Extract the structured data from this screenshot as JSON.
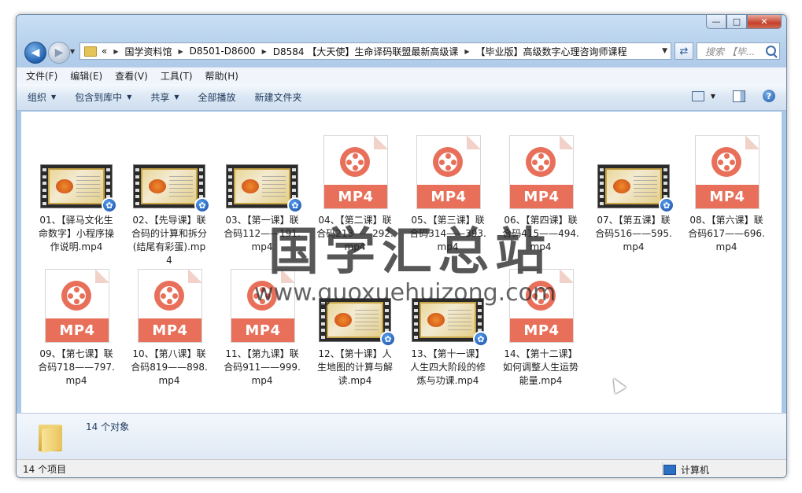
{
  "window": {
    "min_glyph": "—",
    "max_glyph": "□",
    "close_glyph": "✕"
  },
  "address": {
    "crumbs": [
      "«",
      "国学资料馆",
      "D8501-D8600",
      "D8584 【大天使】生命译码联盟最新高级课",
      "【毕业版】高级数字心理咨询师课程"
    ]
  },
  "search": {
    "placeholder": "搜索 【毕..."
  },
  "menu": [
    "文件(F)",
    "编辑(E)",
    "查看(V)",
    "工具(T)",
    "帮助(H)"
  ],
  "toolbar": {
    "organize": "组织",
    "include": "包含到库中",
    "share": "共享",
    "play_all": "全部播放",
    "new_folder": "新建文件夹"
  },
  "files": [
    {
      "name": "01、【驿马文化生命数字】小程序操作说明.mp4",
      "icon": "video-thumbnail"
    },
    {
      "name": "02、【先导课】联合码的计算和拆分(结尾有彩蛋).mp4",
      "icon": "video-thumbnail"
    },
    {
      "name": "03、【第一课】联合码112——191.mp4",
      "icon": "video-thumbnail"
    },
    {
      "name": "04、【第二课】联合码213——292.mp4",
      "icon": "mp4-doc"
    },
    {
      "name": "05、【第三课】联合码314——393.mp4",
      "icon": "mp4-doc"
    },
    {
      "name": "06、【第四课】联合码415——494.mp4",
      "icon": "mp4-doc"
    },
    {
      "name": "07、【第五课】联合码516——595.mp4",
      "icon": "video-thumbnail"
    },
    {
      "name": "08、【第六课】联合码617——696.mp4",
      "icon": "mp4-doc"
    },
    {
      "name": "09、【第七课】联合码718——797.mp4",
      "icon": "mp4-doc"
    },
    {
      "name": "10、【第八课】联合码819——898.mp4",
      "icon": "mp4-doc"
    },
    {
      "name": "11、【第九课】联合码911——999.mp4",
      "icon": "mp4-doc"
    },
    {
      "name": "12、【第十课】人生地图的计算与解读.mp4",
      "icon": "video-thumbnail"
    },
    {
      "name": "13、【第十一课】人生四大阶段的修炼与功课.mp4",
      "icon": "video-thumbnail"
    },
    {
      "name": "14、【第十二课】如何调整人生运势能量.mp4",
      "icon": "mp4-doc"
    }
  ],
  "mp4_label": "MP4",
  "watermark": {
    "cn": "国学汇总站",
    "url": "www.guoxuehuizong.com"
  },
  "details": {
    "count": "14 个对象"
  },
  "status": {
    "items": "14 个项目",
    "location": "计算机"
  }
}
